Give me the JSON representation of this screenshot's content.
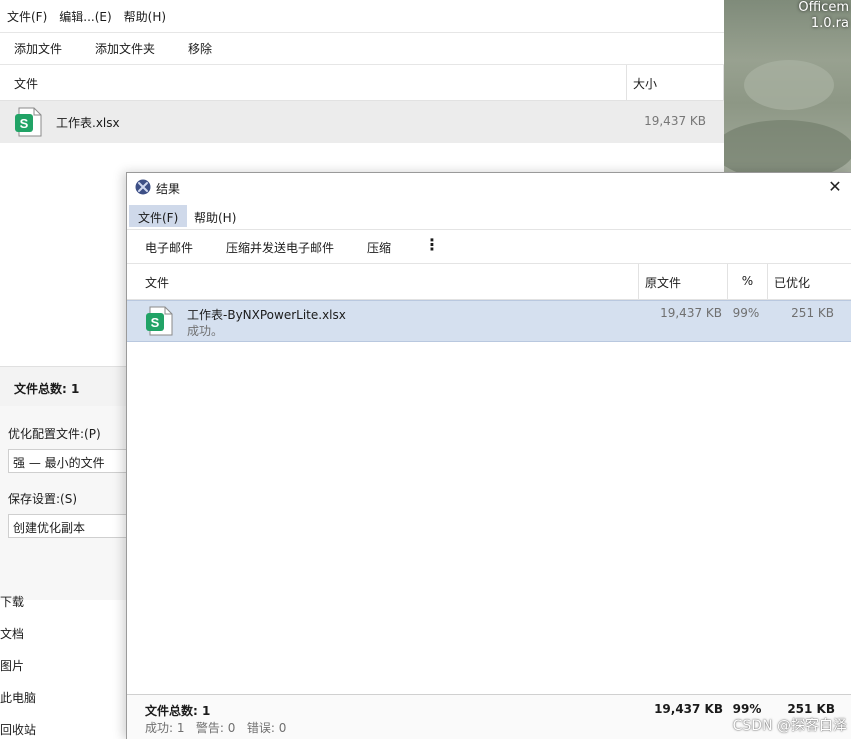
{
  "desktop": {
    "label_line1": "Officem",
    "label_line2": "1.0.ra"
  },
  "main_window": {
    "menu": [
      "文件(F)",
      "编辑...(E)",
      "帮助(H)"
    ],
    "toolbar": [
      "添加文件",
      "添加文件夹",
      "移除"
    ],
    "columns": {
      "name": "文件",
      "size": "大小"
    },
    "file": {
      "name": "工作表.xlsx",
      "size": "19,437 KB",
      "icon": "spreadsheet-icon",
      "icon_letter": "S"
    },
    "summary_label": "文件总数: 1",
    "settings": {
      "profile_label": "优化配置文件:(P)",
      "profile_value": "强 — 最小的文件",
      "save_label": "保存设置:(S)",
      "save_value": "创建优化副本"
    },
    "nav": [
      "下载",
      "文档",
      "图片",
      "此电脑",
      "回收站"
    ]
  },
  "result_window": {
    "title": "结果",
    "close_glyph": "✕",
    "menu": [
      "文件(F)",
      "帮助(H)"
    ],
    "toolbar": [
      "电子邮件",
      "压缩并发送电子邮件",
      "压缩"
    ],
    "more_glyph": "⋮",
    "columns": {
      "file": "文件",
      "original": "原文件",
      "percent": "%",
      "optimized": "已优化"
    },
    "row": {
      "name": "工作表-ByNXPowerLite.xlsx",
      "status": "成功。",
      "original": "19,437 KB",
      "percent": "99%",
      "optimized": "251 KB",
      "icon_letter": "S"
    },
    "footer": {
      "total_label": "文件总数: 1",
      "total_original": "19,437 KB",
      "total_percent": "99%",
      "total_optimized": "251 KB",
      "detail": "成功: 1   警告: 0   错误: 0"
    }
  },
  "watermark": "CSDN @探客白泽",
  "colors": {
    "accent_selection": "#d5e0ef",
    "sheet_green": "#21a366"
  }
}
